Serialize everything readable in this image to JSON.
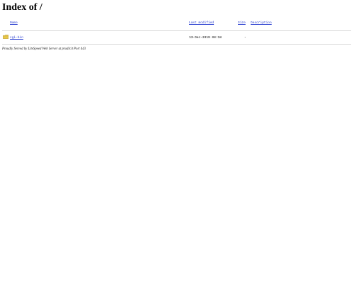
{
  "page": {
    "heading": "Index of /"
  },
  "table": {
    "columns": {
      "name": "Name",
      "last_modified": "Last modified",
      "size": "Size",
      "description": "Description"
    },
    "rows": [
      {
        "icon": "folder-icon",
        "name": "cgi-bin",
        "last_modified": "13-Dec-2019 08:18",
        "size": "-",
        "description": ""
      }
    ]
  },
  "footer": {
    "address": "Proudly Served by LiteSpeed Web Server at prodir.it Port 443"
  },
  "colors": {
    "link": "#2a3fd0",
    "rule": "#d8d8d8",
    "folder": "#e8c84a"
  }
}
